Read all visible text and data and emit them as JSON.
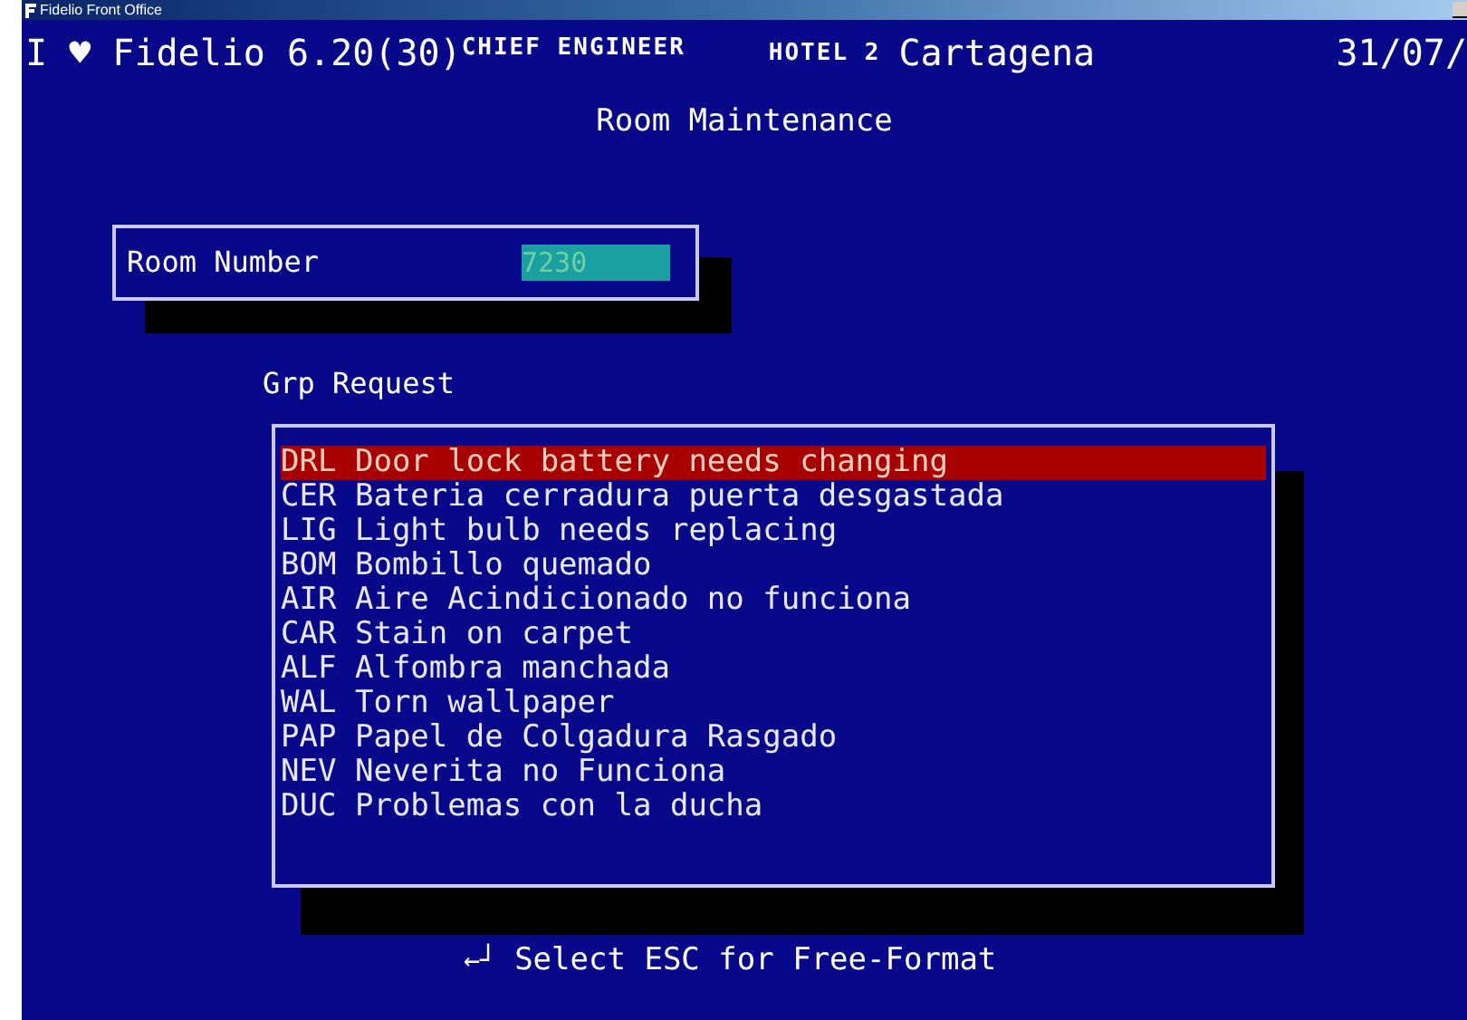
{
  "title_bar": {
    "title": "Fidelio Front Office"
  },
  "header": {
    "app": "I ♥ Fidelio 6.20(30)",
    "role": "CHIEF ENGINEER",
    "hotel_label": "HOTEL 2",
    "hotel_name": "Cartagena",
    "date": "31/07/"
  },
  "screen_title": "Room Maintenance",
  "room_field": {
    "label": "Room Number",
    "value": "7230"
  },
  "list": {
    "title": "Grp Request",
    "items": [
      {
        "code": "DRL",
        "text": "Door lock battery needs changing",
        "selected": true
      },
      {
        "code": "CER",
        "text": "Bateria cerradura puerta desgastada",
        "selected": false
      },
      {
        "code": "LIG",
        "text": "Light bulb needs replacing",
        "selected": false
      },
      {
        "code": "BOM",
        "text": "Bombillo quemado",
        "selected": false
      },
      {
        "code": "AIR",
        "text": "Aire Acindicionado no funciona",
        "selected": false
      },
      {
        "code": "CAR",
        "text": "Stain on carpet",
        "selected": false
      },
      {
        "code": "ALF",
        "text": "Alfombra manchada",
        "selected": false
      },
      {
        "code": "WAL",
        "text": "Torn wallpaper",
        "selected": false
      },
      {
        "code": "PAP",
        "text": "Papel de Colgadura Rasgado",
        "selected": false
      },
      {
        "code": "NEV",
        "text": "Neverita no Funciona",
        "selected": false
      },
      {
        "code": "DUC",
        "text": "Problemas con la ducha",
        "selected": false
      }
    ]
  },
  "footer": {
    "key": "←┘",
    "text": "Select ESC for Free-Format"
  }
}
